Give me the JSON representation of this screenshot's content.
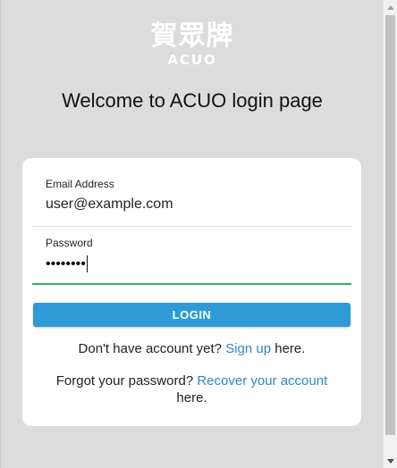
{
  "logo": {
    "chinese_text": "賀眾牌",
    "english_text": "ACUO"
  },
  "page_title": "Welcome to ACUO login page",
  "form": {
    "email": {
      "label": "Email Address",
      "value": "user@example.com"
    },
    "password": {
      "label": "Password",
      "masked_value": "••••••••"
    },
    "login_button": "LOGIN"
  },
  "signup": {
    "prefix": "Don't have account yet?",
    "link_text": "Sign up",
    "suffix": "here."
  },
  "recover": {
    "prefix": "Forgot your password?",
    "link_text": "Recover your account",
    "suffix": "here."
  },
  "colors": {
    "background": "#dcdcdc",
    "button": "#2e9bd6",
    "link": "#2f86cf",
    "focus_underline": "#35b36b"
  }
}
